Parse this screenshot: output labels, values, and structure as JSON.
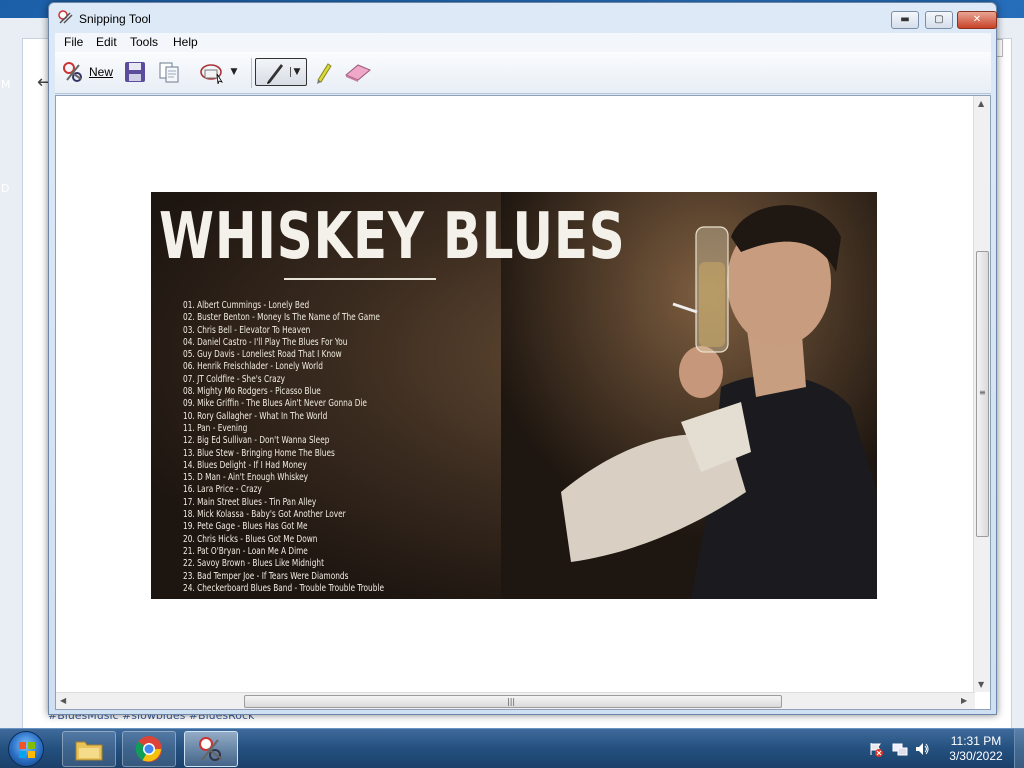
{
  "background": {
    "close_glyph": "✕",
    "back_glyph": "←",
    "menu_glyph": "⋮",
    "side_letters": [
      "M",
      "D"
    ],
    "hashtags": "#BluesMusic #slowblues #BluesRock"
  },
  "window": {
    "title": "Snipping Tool",
    "minimize": "▬",
    "maximize": "▢",
    "close": "✕"
  },
  "menu": [
    "File",
    "Edit",
    "Tools",
    "Help"
  ],
  "toolbar": {
    "new_label": "New",
    "icons": [
      "scissors-icon",
      "save-icon",
      "copy-icon",
      "send-email-icon",
      "pen-icon",
      "highlighter-icon",
      "eraser-icon"
    ],
    "dropdown_glyph": "▼"
  },
  "capture": {
    "title": "WHISKEY BLUES",
    "tracks": [
      "01. Albert Cummings - Lonely Bed",
      "02. Buster Benton - Money Is The Name of The Game",
      "03. Chris Bell - Elevator To Heaven",
      "04. Daniel Castro - I'll Play The Blues For You",
      "05. Guy Davis - Loneliest Road That I Know",
      "06. Henrik Freischlader - Lonely World",
      "07. JT Coldfire - She's Crazy",
      "08. Mighty Mo Rodgers - Picasso Blue",
      "09. Mike Griffin - The Blues Ain't Never Gonna Die",
      "10. Rory Gallagher - What In The World",
      "11. Pan - Evening",
      "12. Big Ed Sullivan - Don't Wanna Sleep",
      "13. Blue Stew - Bringing Home The Blues",
      "14. Blues Delight - If I Had Money",
      "15. D Man - Ain't Enough Whiskey",
      "16. Lara Price - Crazy",
      "17. Main Street Blues - Tin Pan Alley",
      "18. Mick Kolassa - Baby's Got Another Lover",
      "19. Pete Gage - Blues Has Got Me",
      "20. Chris Hicks - Blues Got Me Down",
      "21. Pat O'Bryan - Loan Me A Dime",
      "22. Savoy Brown - Blues Like Midnight",
      "23. Bad Temper Joe - If Tears Were Diamonds",
      "24. Checkerboard Blues Band - Trouble Trouble Trouble"
    ]
  },
  "scroll": {
    "up": "▲",
    "down": "▼",
    "left": "◀",
    "right": "▶",
    "grip_v": "≡",
    "grip_h": "|||"
  },
  "taskbar": {
    "apps": [
      "file-explorer",
      "google-chrome",
      "snipping-tool"
    ],
    "tray_icons": [
      "action-center-icon",
      "network-icon",
      "volume-icon"
    ],
    "time": "11:31 PM",
    "date": "3/30/2022"
  },
  "colors": {
    "title_bar": "#cfe0f2",
    "close_button": "#c8432a",
    "taskbar": "#24507f",
    "canvas": "#ffffff"
  }
}
